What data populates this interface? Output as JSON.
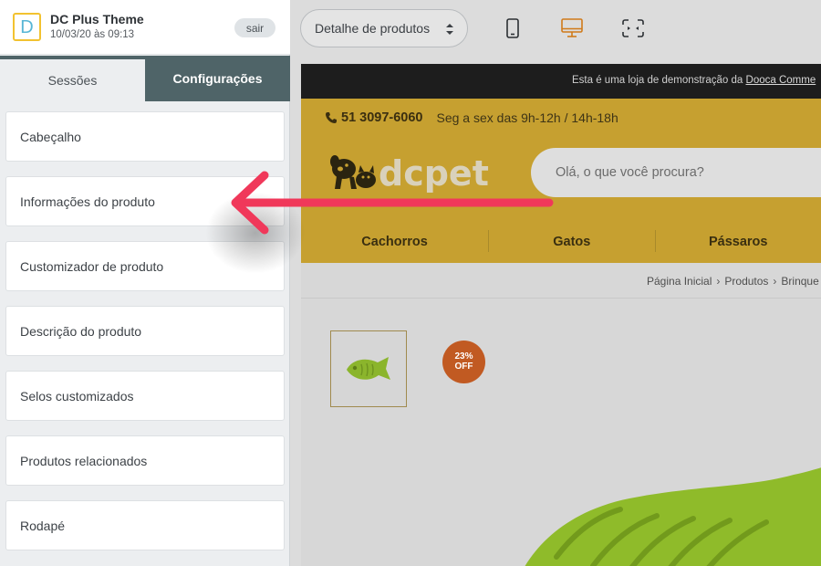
{
  "editor": {
    "theme_logo_letter": "D",
    "theme_name": "DC Plus Theme",
    "theme_date": "10/03/20 às 09:13",
    "logout_label": "sair",
    "tabs": [
      {
        "label": "Sessões"
      },
      {
        "label": "Configurações"
      }
    ],
    "sections": [
      {
        "label": "Cabeçalho"
      },
      {
        "label": "Informações do produto"
      },
      {
        "label": "Customizador de produto"
      },
      {
        "label": "Descrição do produto"
      },
      {
        "label": "Selos customizados"
      },
      {
        "label": "Produtos relacionados"
      },
      {
        "label": "Rodapé"
      }
    ]
  },
  "preview": {
    "page_select_value": "Detalhe de produtos",
    "devices": [
      {
        "icon": "mobile-icon",
        "active": false
      },
      {
        "icon": "desktop-icon",
        "active": true
      },
      {
        "icon": "fullscreen-icon",
        "active": false
      }
    ]
  },
  "store": {
    "demo_text": "Esta é uma loja de demonstração da",
    "demo_link": "Dooca Comme",
    "phone": "51 3097-6060",
    "hours": "Seg a sex das 9h-12h / 14h-18h",
    "brand": "dcpet",
    "search_placeholder": "Olá, o que você procura?",
    "nav": [
      {
        "label": "Cachorros"
      },
      {
        "label": "Gatos"
      },
      {
        "label": "Pássaros"
      }
    ],
    "breadcrumb": [
      {
        "label": "Página Inicial"
      },
      {
        "label": "Produtos"
      },
      {
        "label": "Brinque"
      }
    ],
    "discount": {
      "value": "23%",
      "label": "OFF"
    }
  },
  "colors": {
    "accent_panel": "#4f6468",
    "store_header": "#c6a030",
    "active_device": "#d07a1a",
    "annotation_arrow": "#f0385a",
    "discount_badge": "#c15a22"
  }
}
